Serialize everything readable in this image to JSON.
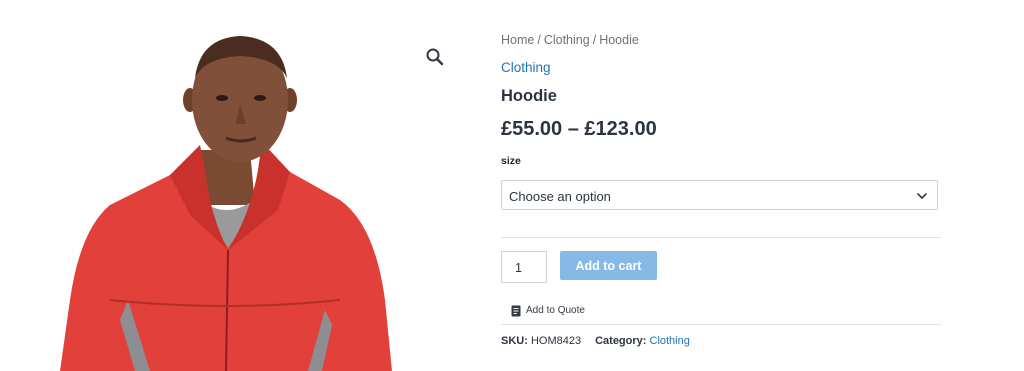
{
  "breadcrumb": {
    "items": [
      "Home",
      "Clothing",
      "Hoodie"
    ],
    "separator": "/"
  },
  "product": {
    "category_link": "Clothing",
    "title": "Hoodie",
    "price_range": "£55.00 – £123.00",
    "attribute_label": "size",
    "select_value": "Choose an option",
    "quantity": "1",
    "add_to_cart_label": "Add to cart",
    "add_to_quote_label": "Add to Quote",
    "sku_label": "SKU:",
    "sku_value": "HOM8423",
    "category_label": "Category:",
    "category_value": "Clothing"
  },
  "icons": {
    "zoom": "magnifier-icon",
    "select": "chevron-down-icon",
    "quote": "document-icon"
  },
  "colors": {
    "link": "#1e73be",
    "button": "#86b9e6",
    "jacket": "#e2403a",
    "text": "#2b3440"
  }
}
